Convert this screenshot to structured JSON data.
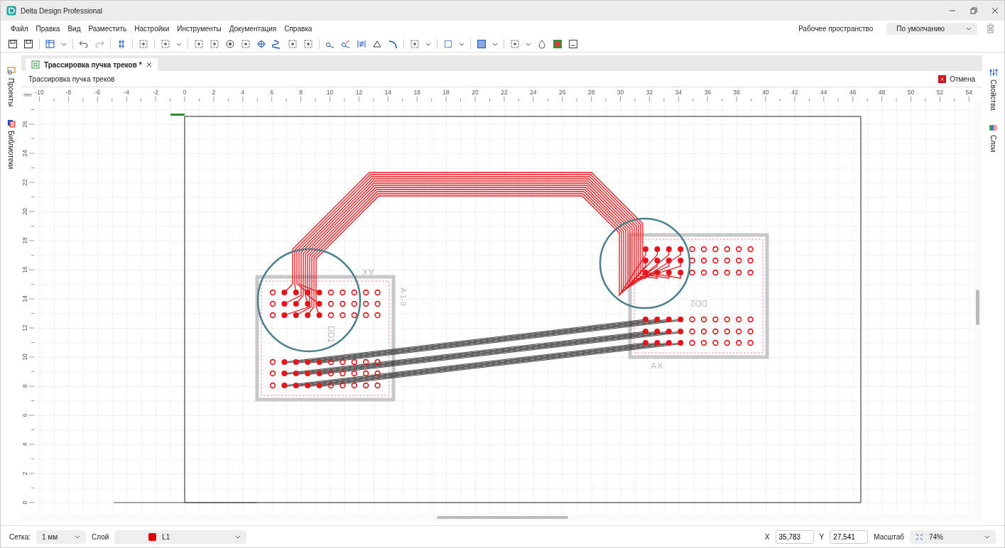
{
  "window": {
    "title": "Delta Design Professional"
  },
  "menu": [
    "Файл",
    "Правка",
    "Вид",
    "Разместить",
    "Настройки",
    "Инструменты",
    "Документация",
    "Справка"
  ],
  "workspace": {
    "label": "Рабочее пространство",
    "value": "По умолчанию"
  },
  "left_sidebar": [
    {
      "label": "Проекты",
      "kind": "projects"
    },
    {
      "label": "Библиотеки",
      "kind": "libraries"
    }
  ],
  "right_sidebar": [
    {
      "label": "Свойства",
      "kind": "properties"
    },
    {
      "label": "Слои",
      "kind": "layers"
    }
  ],
  "tabs": [
    {
      "label": "Трассировка пучка треков *",
      "selected": true
    }
  ],
  "panel": {
    "title": "Трассировка пучка треков",
    "cancel": "Отмена"
  },
  "ruler": {
    "unit": "mm",
    "x_labels": [
      "-10",
      "-8",
      "-6",
      "-4",
      "-2",
      "0",
      "2",
      "4",
      "6",
      "8",
      "10",
      "12",
      "14",
      "16",
      "18",
      "20",
      "22",
      "24",
      "26",
      "28",
      "30",
      "32",
      "34",
      "36",
      "38",
      "40",
      "42",
      "44",
      "46",
      "48",
      "50",
      "52",
      "54"
    ],
    "y_labels": [
      "0",
      "2",
      "4",
      "6",
      "8",
      "10",
      "12",
      "14",
      "16",
      "18",
      "20",
      "22",
      "24",
      "26"
    ]
  },
  "canvas": {
    "components": [
      {
        "designator": "DD1",
        "labels": [
          "A K",
          "A 1-9"
        ]
      },
      {
        "designator": "DD2",
        "labels": [
          "A K"
        ]
      }
    ]
  },
  "status_bar": {
    "grid_label": "Сетка:",
    "grid_value": "1 мм",
    "layer_label": "Слой",
    "layer_value": "L1",
    "x_label": "X",
    "x_value": "35,783",
    "y_label": "Y",
    "y_value": "27,541",
    "zoom_label": "Масштаб",
    "zoom_value": "74%"
  }
}
